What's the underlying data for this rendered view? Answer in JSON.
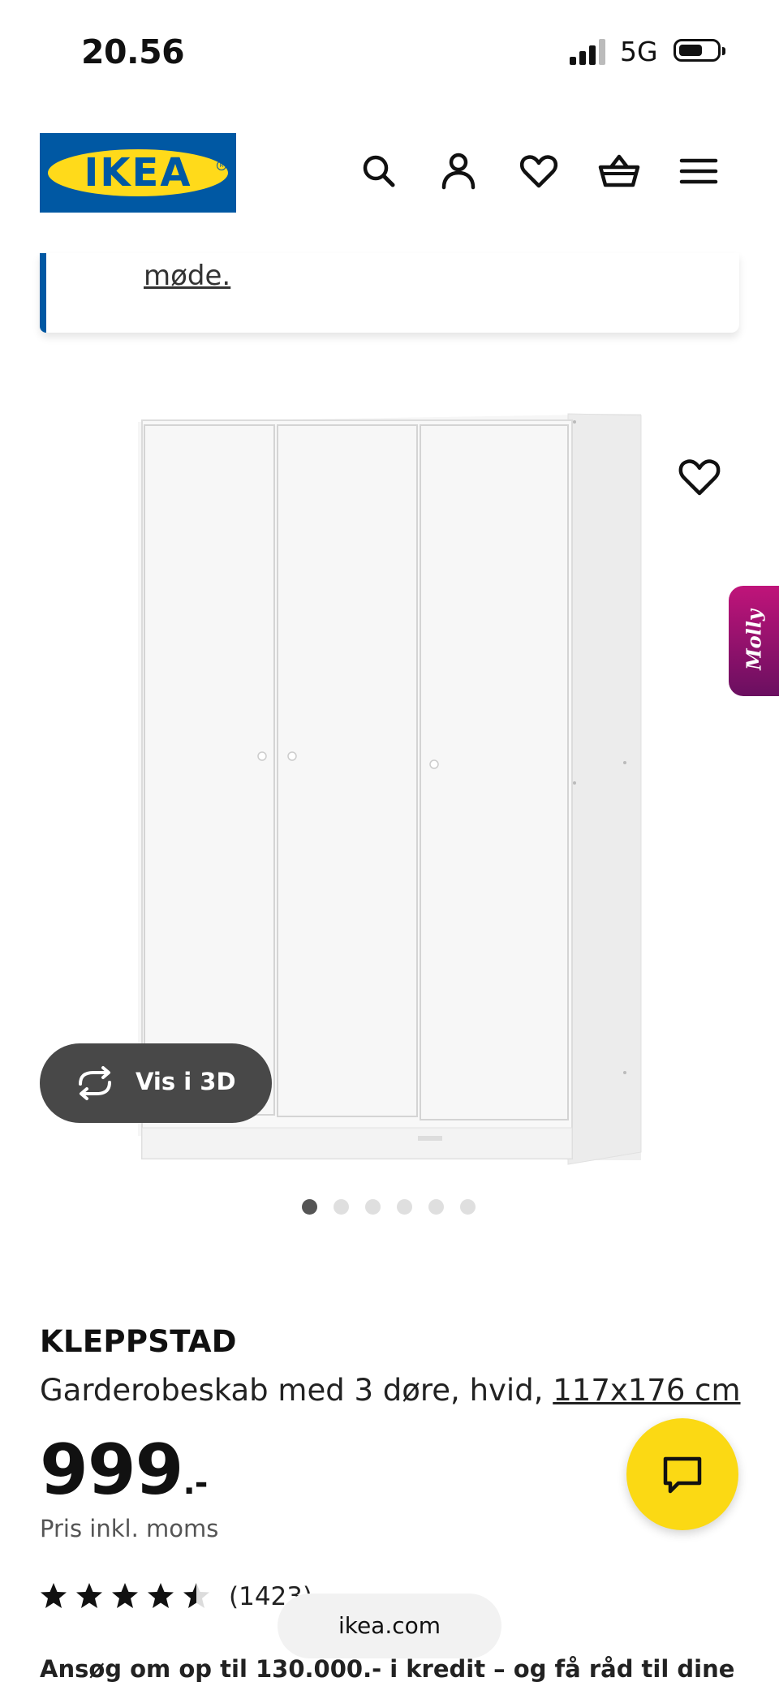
{
  "status_bar": {
    "time": "20.56",
    "network": "5G"
  },
  "header": {
    "logo_text": "IKEA",
    "icons": [
      "search-icon",
      "account-icon",
      "heart-icon",
      "basket-icon",
      "menu-icon"
    ]
  },
  "notice": {
    "link_text": "møde."
  },
  "product": {
    "vis_3d_label": "Vis i 3D",
    "brand": "KLEPPSTAD",
    "description": "Garderobeskab med 3 døre, hvid,",
    "dimensions": "117x176 cm",
    "price_whole": "999",
    "price_suffix": ".-",
    "price_note": "Pris inkl. moms",
    "rating": 4.5,
    "rating_max": 5,
    "reviews_count": "(1423)",
    "image_count": 6,
    "active_image": 1
  },
  "assistant": {
    "label": "Molly"
  },
  "browser": {
    "url": "ikea.com"
  },
  "credit_text": "Ansøg om op til 130.000.- i kredit – og få råd til dine",
  "colors": {
    "ikea_blue": "#0058a3",
    "ikea_yellow": "#ffda1a",
    "chat_yellow": "#fbd914",
    "molly_magenta": "#c0147a"
  }
}
